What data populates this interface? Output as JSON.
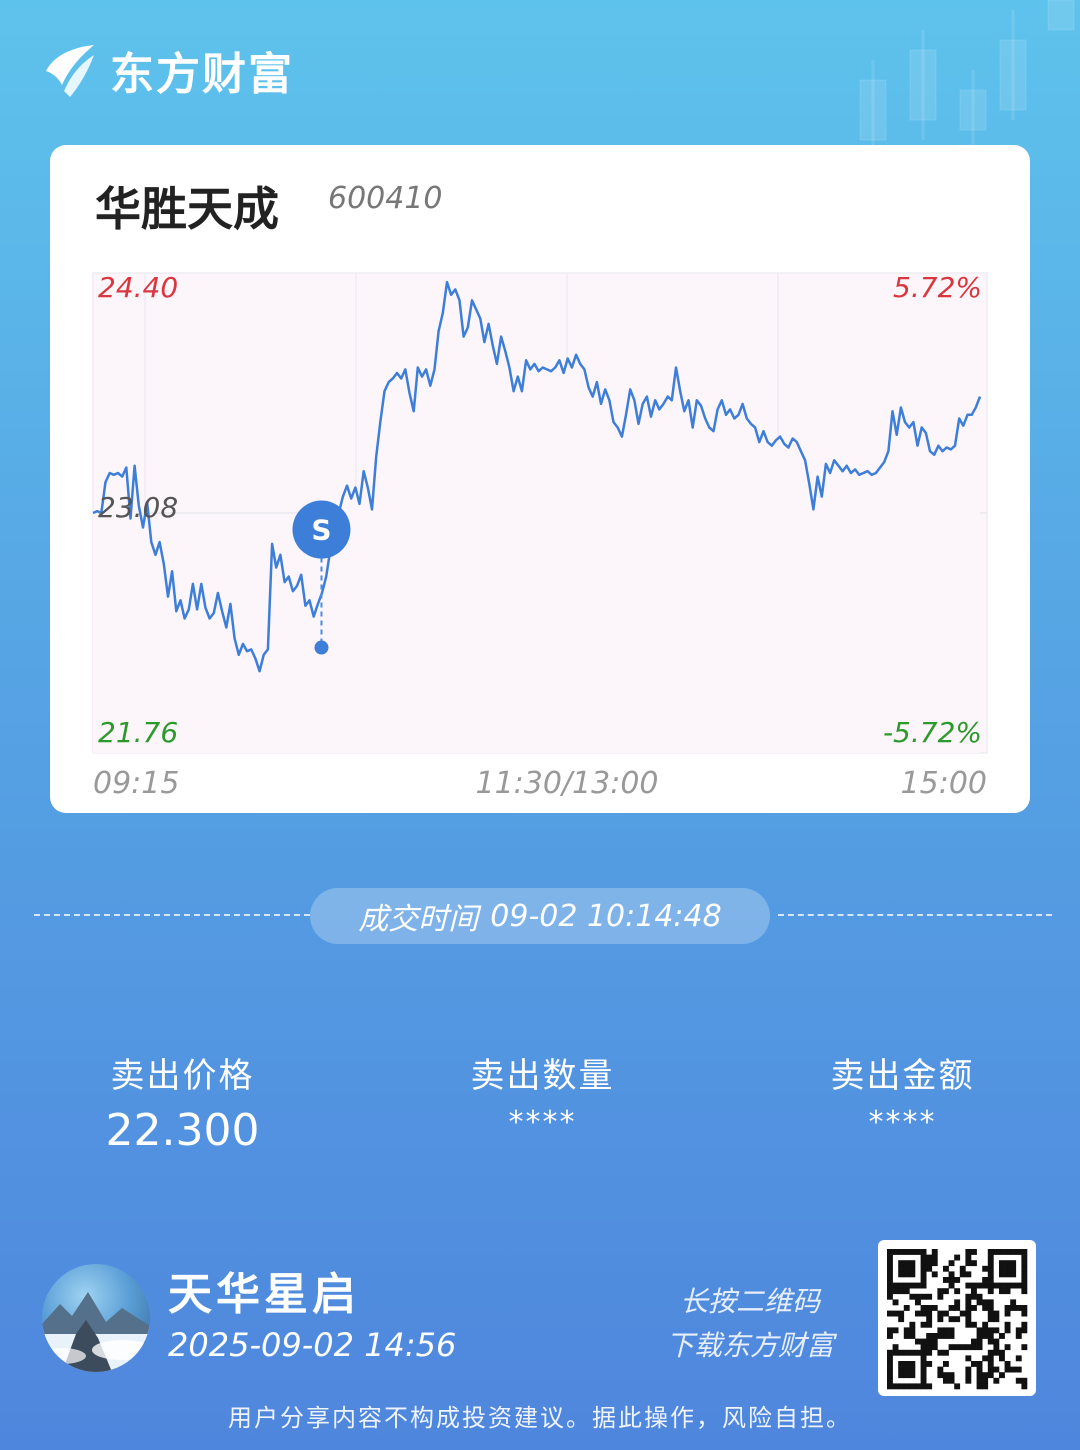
{
  "brand": {
    "name": "东方财富"
  },
  "stock": {
    "name": "华胜天成",
    "code": "600410"
  },
  "chart_data": {
    "type": "line",
    "y_left_ticks": [
      "24.40",
      "23.08",
      "21.76"
    ],
    "y_right_ticks": [
      "5.72%",
      "-5.72%"
    ],
    "x_ticks": [
      "09:15",
      "11:30/13:00",
      "15:00"
    ],
    "ylim": [
      21.76,
      24.4
    ],
    "prev_close": 23.08,
    "colors": {
      "up": "#d9363e",
      "down": "#2a9a2a",
      "line": "#3d7ed8",
      "fill": "#fcf5fa"
    },
    "series": [
      {
        "values": [
          23.08,
          23.09,
          23.08,
          23.25,
          23.3,
          23.29,
          23.3,
          23.28,
          23.33,
          23.05,
          23.34,
          23.12,
          23.0,
          23.14,
          22.92,
          22.85,
          22.92,
          22.8,
          22.62,
          22.76,
          22.54,
          22.6,
          22.5,
          22.55,
          22.69,
          22.55,
          22.69,
          22.56,
          22.5,
          22.53,
          22.64,
          22.54,
          22.45,
          22.58,
          22.39,
          22.3,
          22.36,
          22.32,
          22.33,
          22.28,
          22.21,
          22.3,
          22.33,
          22.91,
          22.78,
          22.85,
          22.7,
          22.73,
          22.65,
          22.68,
          22.74,
          22.57,
          22.6,
          22.51,
          22.58,
          22.64,
          22.73,
          22.88,
          22.95,
          23.08,
          23.17,
          23.23,
          23.16,
          23.22,
          23.13,
          23.31,
          23.22,
          23.1,
          23.39,
          23.58,
          23.75,
          23.8,
          23.82,
          23.85,
          23.82,
          23.87,
          23.74,
          23.64,
          23.88,
          23.83,
          23.87,
          23.78,
          23.87,
          24.08,
          24.18,
          24.35,
          24.28,
          24.31,
          24.25,
          24.05,
          24.1,
          24.25,
          24.2,
          24.15,
          24.02,
          24.12,
          24.0,
          23.9,
          24.05,
          23.97,
          23.88,
          23.75,
          23.83,
          23.75,
          23.92,
          23.87,
          23.9,
          23.86,
          23.88,
          23.87,
          23.86,
          23.88,
          23.92,
          23.85,
          23.93,
          23.88,
          23.95,
          23.9,
          23.87,
          23.77,
          23.72,
          23.8,
          23.68,
          23.76,
          23.7,
          23.58,
          23.55,
          23.5,
          23.62,
          23.76,
          23.7,
          23.57,
          23.68,
          23.72,
          23.61,
          23.7,
          23.65,
          23.68,
          23.72,
          23.7,
          23.88,
          23.75,
          23.64,
          23.7,
          23.55,
          23.7,
          23.67,
          23.6,
          23.55,
          23.53,
          23.65,
          23.7,
          23.62,
          23.65,
          23.6,
          23.62,
          23.68,
          23.6,
          23.57,
          23.55,
          23.47,
          23.53,
          23.47,
          23.45,
          23.48,
          23.5,
          23.46,
          23.44,
          23.49,
          23.47,
          23.42,
          23.37,
          23.24,
          23.1,
          23.28,
          23.17,
          23.35,
          23.3,
          23.37,
          23.34,
          23.31,
          23.34,
          23.3,
          23.32,
          23.29,
          23.3,
          23.31,
          23.29,
          23.3,
          23.33,
          23.36,
          23.42,
          23.64,
          23.51,
          23.66,
          23.58,
          23.55,
          23.58,
          23.45,
          23.55,
          23.52,
          23.42,
          23.4,
          23.45,
          23.42,
          23.44,
          23.43,
          23.45,
          23.6,
          23.56,
          23.62,
          23.62,
          23.66,
          23.72
        ]
      }
    ],
    "marker": {
      "label": "S",
      "value": 22.34,
      "time": "10:14"
    }
  },
  "trade": {
    "time_label": "成交时间",
    "time_value": "09-02 10:14:48"
  },
  "stats": [
    {
      "label": "卖出价格",
      "value": "22.300"
    },
    {
      "label": "卖出数量",
      "value": "****"
    },
    {
      "label": "卖出金额",
      "value": "****"
    }
  ],
  "user": {
    "name": "天华星启",
    "time": "2025-09-02 14:56"
  },
  "hint": {
    "line1": "长按二维码",
    "line2": "下载东方财富"
  },
  "disclaimer": "用户分享内容不构成投资建议。据此操作，风险自担。"
}
